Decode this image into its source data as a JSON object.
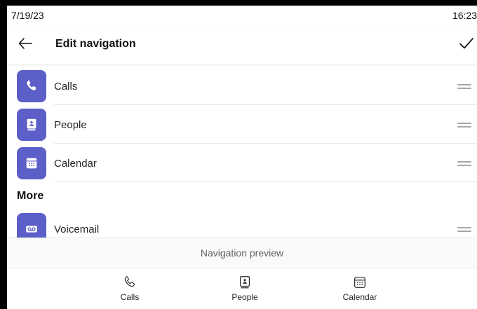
{
  "status_bar": {
    "date": "7/19/23",
    "time": "16:23"
  },
  "header": {
    "title": "Edit navigation"
  },
  "nav_items": [
    {
      "label": "Calls",
      "icon": "phone-icon"
    },
    {
      "label": "People",
      "icon": "contact-book-icon"
    },
    {
      "label": "Calendar",
      "icon": "calendar-icon"
    }
  ],
  "more_section": {
    "title": "More",
    "items": [
      {
        "label": "Voicemail",
        "icon": "voicemail-icon"
      }
    ]
  },
  "preview": {
    "label": "Navigation preview"
  },
  "bottom_nav": [
    {
      "label": "Calls",
      "icon": "phone-icon"
    },
    {
      "label": "People",
      "icon": "contact-book-icon"
    },
    {
      "label": "Calendar",
      "icon": "calendar-icon"
    }
  ],
  "colors": {
    "accent": "#5b5fc7",
    "background": "#ffffff",
    "frame": "#000000"
  }
}
